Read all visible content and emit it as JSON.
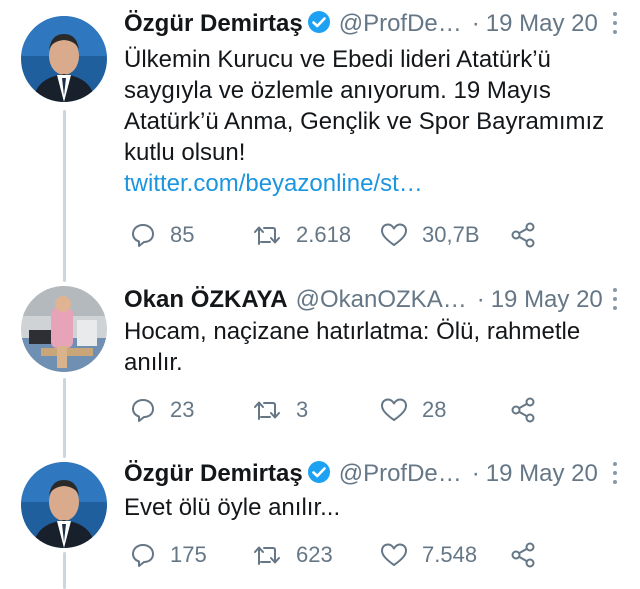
{
  "tweets": [
    {
      "name": "Özgür Demirtaş",
      "handle": "@ProfDe…",
      "date": "19 May 20",
      "verified": true,
      "text_lines": [
        "Ülkemin Kurucu ve Ebedi lideri Atatürk’ü",
        "saygıyla ve özlemle anıyorum. 19 Mayıs",
        "Atatürk’ü Anma, Gençlik ve Spor Bayramımız",
        "kutlu olsun!"
      ],
      "link": "twitter.com/beyazonline/st…",
      "replies": "85",
      "retweets": "2.618",
      "likes": "30,7B"
    },
    {
      "name": "Okan ÖZKAYA",
      "handle": "@OkanOZKA…",
      "date": "19 May 20",
      "verified": false,
      "text_lines": [
        "Hocam, naçizane hatırlatma: Ölü, rahmetle",
        "anılır."
      ],
      "replies": "23",
      "retweets": "3",
      "likes": "28"
    },
    {
      "name": "Özgür Demirtaş",
      "handle": "@ProfDe…",
      "date": "19 May 20",
      "verified": true,
      "text_lines": [
        "Evet ölü öyle anılır..."
      ],
      "replies": "175",
      "retweets": "623",
      "likes": "7.548"
    }
  ],
  "separator": "·",
  "colors": {
    "text": "#14171a",
    "secondary": "#657786",
    "link": "#1b95e0",
    "verified": "#1da1f2",
    "thread_line": "#ccd6dd"
  },
  "icons": [
    "verified-badge-icon",
    "more-icon",
    "reply-icon",
    "retweet-icon",
    "like-icon",
    "share-icon"
  ]
}
